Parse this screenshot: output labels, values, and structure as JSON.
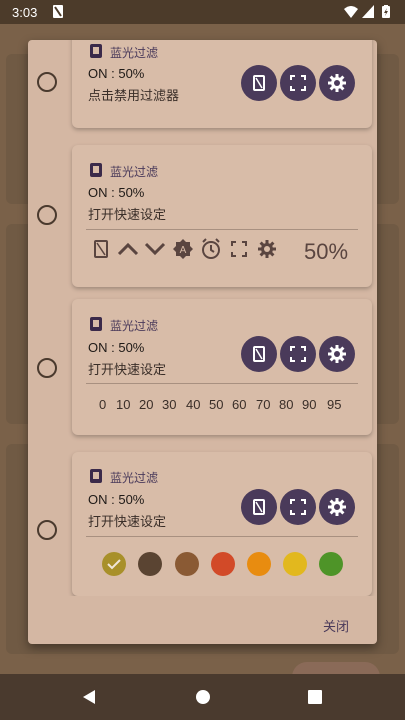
{
  "status_bar": {
    "time": "3:03",
    "icons": [
      "screen-filter-icon",
      "wifi-icon",
      "signal-icon",
      "battery-charging-icon"
    ]
  },
  "cards": [
    {
      "app_name": "蓝光过滤",
      "status": "ON : 50%",
      "action": "点击禁用过滤器",
      "buttons": [
        "toggle-filter-icon",
        "fullscreen-icon",
        "settings-icon"
      ]
    },
    {
      "app_name": "蓝光过滤",
      "status": "ON : 50%",
      "action": "打开快速设定",
      "toolbar_icons": [
        "toggle-filter-icon",
        "chevron-up-icon",
        "chevron-down-icon",
        "auto-brightness-icon",
        "alarm-icon",
        "fullscreen-icon",
        "settings-icon"
      ],
      "percent_label": "50%"
    },
    {
      "app_name": "蓝光过滤",
      "status": "ON : 50%",
      "action": "打开快速设定",
      "buttons": [
        "toggle-filter-icon",
        "fullscreen-icon",
        "settings-icon"
      ],
      "levels": [
        "0",
        "10",
        "20",
        "30",
        "40",
        "50",
        "60",
        "70",
        "80",
        "90",
        "95"
      ]
    },
    {
      "app_name": "蓝光过滤",
      "status": "ON : 50%",
      "action": "打开快速设定",
      "buttons": [
        "toggle-filter-icon",
        "fullscreen-icon",
        "settings-icon"
      ],
      "colors": [
        "#a8902a",
        "#5a4432",
        "#8a5a34",
        "#d24a28",
        "#e88c10",
        "#e2b81e",
        "#4e9428"
      ],
      "selected_color_index": 0
    }
  ],
  "dialog": {
    "close_label": "关闭"
  },
  "nav": {
    "icons": [
      "back-icon",
      "home-icon",
      "recents-icon"
    ]
  }
}
